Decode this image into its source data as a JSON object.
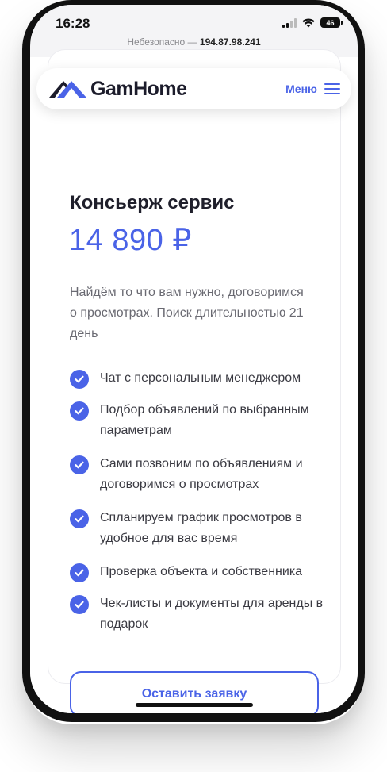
{
  "status_bar": {
    "time": "16:28",
    "battery": "46"
  },
  "browser": {
    "security_label": "Небезопасно",
    "separator": " — ",
    "host": "194.87.98.241"
  },
  "header": {
    "logo_text": "GamHome",
    "menu_label": "Меню"
  },
  "card": {
    "title": "Консьерж сервис",
    "price": "14 890 ₽",
    "description": "Найдём то что вам нужно, договоримся о просмотрах. Поиск длительностью 21 день",
    "features": [
      "Чат с персональным менеджером",
      "Подбор объявлений по выбранным параметрам",
      "Сами позвоним по объявлениям и договоримся о просмотрах",
      "Спланируем график просмотров в удобное для вас время",
      "Проверка объекта и собственника",
      "Чек-листы и документы для аренды в подарок"
    ],
    "cta_label": "Оставить заявку"
  },
  "colors": {
    "accent": "#4a63e7",
    "text_dark": "#1f1f2b",
    "text_muted": "#6a6a72",
    "green_border": "#4caf50"
  },
  "icons": {
    "logo": "house-roof-icon",
    "menu": "hamburger-icon",
    "check": "check-circle-icon",
    "wifi": "wifi-icon",
    "signal": "cellular-signal-icon",
    "battery": "battery-icon"
  }
}
